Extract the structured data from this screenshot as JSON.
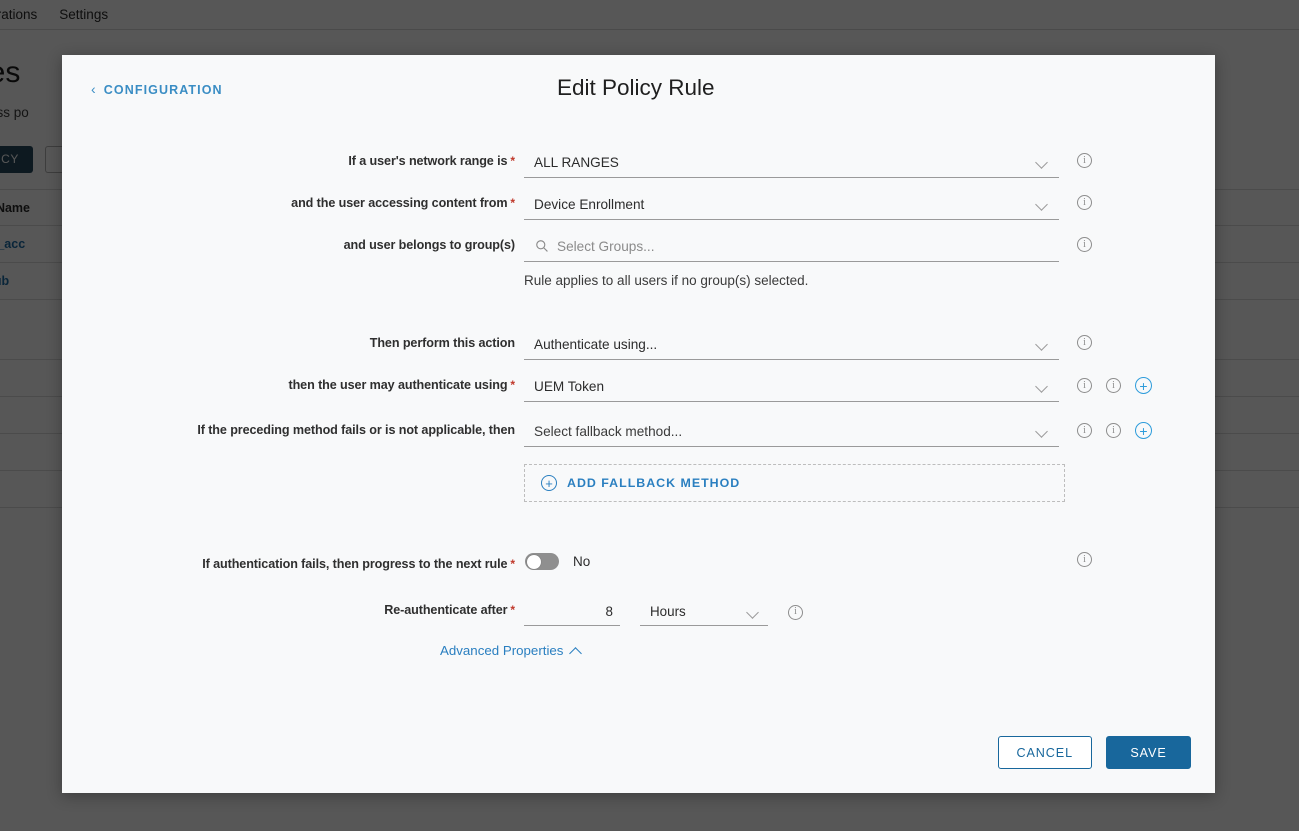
{
  "background": {
    "nav_tabs": [
      "tegrations",
      "Settings"
    ],
    "page_title": "ies",
    "page_subtitle": "access po",
    "primary_button": "OLICY",
    "table": {
      "header": "olicy Name",
      "rows": [
        "efault_acc",
        "est-hub"
      ]
    }
  },
  "modal": {
    "back_link": "CONFIGURATION",
    "title": "Edit Policy Rule",
    "fields": {
      "network_range": {
        "label": "If a user's network range is",
        "required": true,
        "value": "ALL RANGES"
      },
      "accessing_from": {
        "label": "and the user accessing content from",
        "required": true,
        "value": "Device Enrollment"
      },
      "groups": {
        "label": "and user belongs to group(s)",
        "required": false,
        "placeholder": "Select Groups...",
        "helper": "Rule applies to all users if no group(s) selected."
      },
      "action": {
        "label": "Then perform this action",
        "required": false,
        "value": "Authenticate using..."
      },
      "auth_method": {
        "label": "then the user may authenticate using",
        "required": true,
        "value": "UEM Token"
      },
      "fallback": {
        "label": "If the preceding method fails or is not applicable, then",
        "required": false,
        "value": "Select fallback method..."
      },
      "add_fallback_button": "ADD FALLBACK METHOD",
      "progress_next_rule": {
        "label": "If authentication fails, then progress to the next rule",
        "required": true,
        "toggle_state": "No"
      },
      "reauthenticate": {
        "label": "Re-authenticate after",
        "required": true,
        "value": "8",
        "unit": "Hours"
      },
      "advanced_properties": "Advanced Properties"
    },
    "footer": {
      "cancel": "CANCEL",
      "save": "SAVE"
    }
  },
  "icons": {
    "info": "i",
    "plus": "+",
    "search": "search-icon",
    "chevron_left": "‹"
  },
  "colors": {
    "accent_blue": "#18679c",
    "link_blue": "#2a7fc0",
    "required_red": "#c0392b",
    "modal_bg": "#f8f9fa"
  }
}
